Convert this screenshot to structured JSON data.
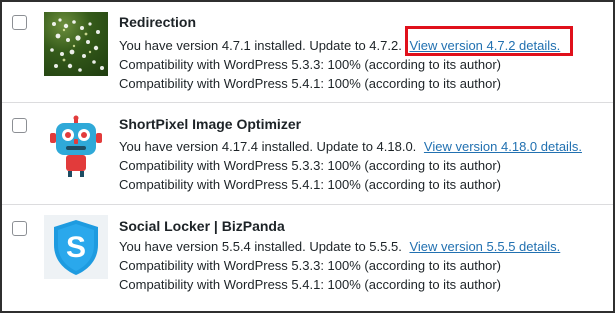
{
  "plugins": [
    {
      "name": "Redirection",
      "update_text": "You have version 4.7.1 installed. Update to 4.7.2.",
      "link_text": "View version 4.7.2 details.",
      "compat_1": "Compatibility with WordPress 5.3.3: 100% (according to its author)",
      "compat_2": "Compatibility with WordPress 5.4.1: 100% (according to its author)",
      "icon": "flowers-thumbnail"
    },
    {
      "name": "ShortPixel Image Optimizer",
      "update_text": "You have version 4.17.4 installed. Update to 4.18.0.",
      "link_text": "View version 4.18.0 details.",
      "compat_1": "Compatibility with WordPress 5.3.3: 100% (according to its author)",
      "compat_2": "Compatibility with WordPress 5.4.1: 100% (according to its author)",
      "icon": "robot-icon"
    },
    {
      "name": "Social Locker | BizPanda",
      "update_text": "You have version 5.5.4 installed. Update to 5.5.5.",
      "link_text": "View version 5.5.5 details.",
      "compat_1": "Compatibility with WordPress 5.3.3: 100% (according to its author)",
      "compat_2": "Compatibility with WordPress 5.4.1: 100% (according to its author)",
      "icon": "shield-s-icon"
    }
  ],
  "colors": {
    "link": "#2271b1",
    "highlight": "#e0101b",
    "text": "#1d2327"
  }
}
